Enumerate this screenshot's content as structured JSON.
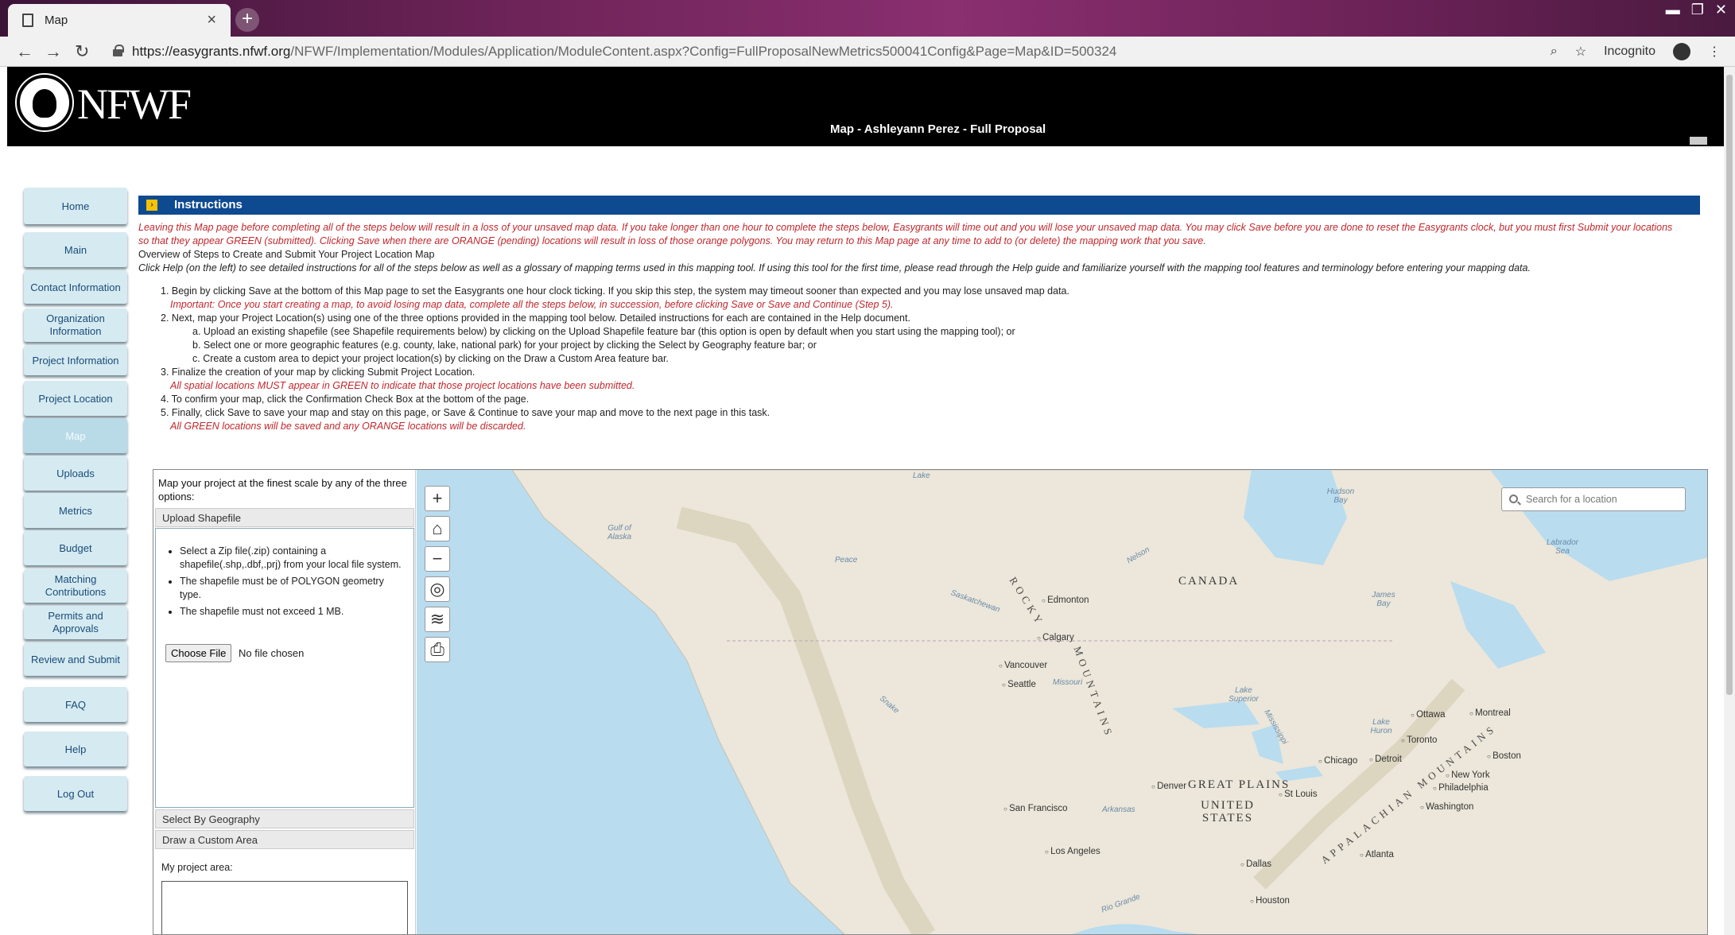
{
  "browser": {
    "tab_title": "Map",
    "tab_close": "×",
    "new_tab": "+",
    "url_host": "https://easygrants.nfwf.org",
    "url_path": "/NFWF/Implementation/Modules/Application/ModuleContent.aspx?Config=FullProposalNewMetrics500041Config&Page=Map&ID=500324",
    "incognito_label": "Incognito",
    "win_minimize": "▬",
    "win_restore": "❐",
    "win_close": "✕"
  },
  "header": {
    "logo_text": "NFWF",
    "page_heading": "Map - Ashleyann Perez - Full Proposal"
  },
  "sidebar": {
    "items": [
      {
        "label": "Home"
      },
      {
        "label": "Main"
      },
      {
        "label": "Contact Information"
      },
      {
        "label": "Organization Information"
      },
      {
        "label": "Project Information"
      },
      {
        "label": "Project Location"
      },
      {
        "label": "Map"
      },
      {
        "label": "Uploads"
      },
      {
        "label": "Metrics"
      },
      {
        "label": "Budget"
      },
      {
        "label": "Matching Contributions"
      },
      {
        "label": "Permits and Approvals"
      },
      {
        "label": "Review and Submit"
      },
      {
        "label": "FAQ"
      },
      {
        "label": "Help"
      },
      {
        "label": "Log Out"
      }
    ]
  },
  "instructions": {
    "heading": "Instructions",
    "warning_1": "Leaving this Map page before completing all of the steps below will result in a loss of your unsaved map data. If you take longer than one hour to complete the steps below, Easygrants will time out and you will lose your unsaved map data. You may click Save before you are done to reset the Easygrants clock, but you must first Submit your locations",
    "warning_2": "so that they appear GREEN (submitted). Clicking Save when there are ORANGE (pending) locations will result in loss of those orange polygons. You may return to this Map page at any time to add to (or delete) the mapping work that you save.",
    "overview": "Overview of Steps to Create and Submit Your Project Location Map",
    "help_note": "Click Help (on the left) to see detailed instructions for all of the steps below as well as a glossary of mapping terms used in this mapping tool. If using this tool for the first time, please read through the Help guide and familiarize yourself with the mapping tool features and terminology before entering your mapping data.",
    "step1": "1. Begin by clicking Save at the bottom of this Map page to set the Easygrants one hour clock ticking.  If you skip this step, the system may timeout sooner than expected and you may lose unsaved map data.",
    "step1_note": "Important: Once you start creating a map, to avoid losing map data, complete all the steps below, in succession, before clicking Save or Save and Continue (Step 5).",
    "step2": "2. Next, map your Project Location(s) using one of the three options provided in the mapping tool below.  Detailed instructions for each are contained in the Help document.",
    "step2a": "a. Upload an existing shapefile (see Shapefile requirements below) by clicking on the Upload Shapefile feature bar (this option is open by default when you start using the mapping tool); or",
    "step2b": "b. Select one or more geographic features (e.g. county, lake, national park) for your project by clicking the Select by Geography feature bar; or",
    "step2c": "c. Create a custom area to depict your project location(s) by clicking on the Draw a Custom Area feature bar.",
    "step3": "3. Finalize the creation of your map by clicking Submit Project Location.",
    "step3_note": "All spatial locations MUST appear in GREEN to indicate that those project locations have been submitted.",
    "step4": "4. To confirm your map, click the Confirmation Check Box at the bottom of the page.",
    "step5": "5. Finally, click Save to save your map and stay on this page, or Save & Continue to save your map and move to the next page in this task.",
    "step5_note": "All GREEN locations will be saved and any ORANGE locations will be discarded."
  },
  "map_panel": {
    "intro": "Map your project at the finest scale by any of the three options:",
    "upload_shapefile": "Upload Shapefile",
    "bullets": [
      "Select a Zip file(.zip) containing a shapefile(.shp,.dbf,.prj) from your local file system.",
      "The shapefile must be of POLYGON geometry type.",
      "The shapefile must not exceed 1 MB."
    ],
    "choose_file": "Choose File",
    "no_file": "No file chosen",
    "select_by_geography": "Select By Geography",
    "draw_custom_area": "Draw a Custom Area",
    "project_area_label": "My project area:"
  },
  "map": {
    "search_placeholder": "Search for a location",
    "labels": {
      "canada": "CANADA",
      "united_states": "UNITED STATES",
      "great_plains": "GREAT PLAINS",
      "rocky": "ROCKY",
      "mountains": "MOUNTAINS",
      "appalachian": "APPALACHIAN MOUNTAINS",
      "edmonton": "Edmonton",
      "calgary": "Calgary",
      "vancouver": "Vancouver",
      "seattle": "Seattle",
      "san_francisco": "San Francisco",
      "los_angeles": "Los Angeles",
      "denver": "Denver",
      "dallas": "Dallas",
      "houston": "Houston",
      "chicago": "Chicago",
      "detroit": "Detroit",
      "toronto": "Toronto",
      "ottawa": "Ottawa",
      "montreal": "Montreal",
      "boston": "Boston",
      "new_york": "New York",
      "philadelphia": "Philadelphia",
      "washington": "Washington",
      "atlanta": "Atlanta",
      "st_louis": "St Louis",
      "hudson_bay": "Hudson Bay",
      "james_bay": "James Bay",
      "labrador_sea": "Labrador Sea",
      "gulf_alaska": "Gulf of Alaska",
      "lake_superior": "Lake Superior",
      "lake_huron": "Lake Huron",
      "missouri": "Missouri",
      "nelson": "Nelson",
      "arkansas": "Arkansas",
      "peace": "Peace",
      "snake": "Snake",
      "rio_grande": "Rio Grande",
      "saskatchewan": "Saskatchewan",
      "mississippi": "Mississippi",
      "lake": "Lake"
    }
  }
}
